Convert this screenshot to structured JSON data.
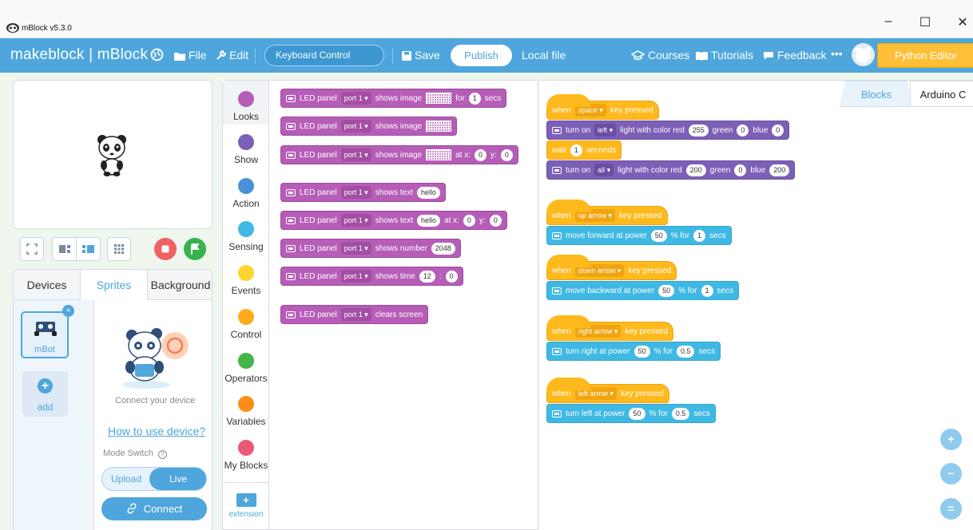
{
  "window": {
    "title": "mBlock v5.3.0",
    "minimize": "–",
    "maximize": "☐",
    "close": "✕"
  },
  "topbar": {
    "brand": "makeblock | mBlock",
    "file": "File",
    "edit": "Edit",
    "project_name": "Keyboard Control",
    "save": "Save",
    "publish": "Publish",
    "local_file": "Local file",
    "courses": "Courses",
    "tutorials": "Tutorials",
    "feedback": "Feedback",
    "more": "•••",
    "python_editor": "Python Editor"
  },
  "left_panel": {
    "tabs": [
      "Devices",
      "Sprites",
      "Background"
    ],
    "active_tab": "Sprites",
    "sprite_name": "mBot",
    "add_label": "add",
    "connect_text": "Connect your device",
    "how_to": "How to use device?",
    "mode_switch": "Mode Switch",
    "upload": "Upload",
    "live": "Live",
    "connect_button": "Connect"
  },
  "categories": [
    {
      "label": "Looks",
      "color": "#b65db7"
    },
    {
      "label": "Show",
      "color": "#7c5fb6"
    },
    {
      "label": "Action",
      "color": "#4a90d9"
    },
    {
      "label": "Sensing",
      "color": "#3fb9e4"
    },
    {
      "label": "Events",
      "color": "#ffd52e"
    },
    {
      "label": "Control",
      "color": "#ffab19"
    },
    {
      "label": "Operators",
      "color": "#43b549"
    },
    {
      "label": "Variables",
      "color": "#ff8c1a"
    },
    {
      "label": "My Blocks",
      "color": "#ea5a78"
    }
  ],
  "extension_label": "extension",
  "palette_blocks": {
    "b1": {
      "t1": "LED panel",
      "port": "port 1 ▾",
      "t2": "shows image",
      "t3": "for",
      "v1": "1",
      "t4": "secs"
    },
    "b2": {
      "t1": "LED panel",
      "port": "port 1 ▾",
      "t2": "shows image"
    },
    "b3": {
      "t1": "LED panel",
      "port": "port 1 ▾",
      "t2": "shows image",
      "t3": "at x:",
      "v1": "0",
      "t4": "y:",
      "v2": "0"
    },
    "b4": {
      "t1": "LED panel",
      "port": "port 1 ▾",
      "t2": "shows text",
      "v1": "hello"
    },
    "b5": {
      "t1": "LED panel",
      "port": "port 1 ▾",
      "t2": "shows text",
      "v1": "hello",
      "t3": "at x:",
      "v2": "0",
      "t4": "y:",
      "v3": "0"
    },
    "b6": {
      "t1": "LED panel",
      "port": "port 1 ▾",
      "t2": "shows number",
      "v1": "2048"
    },
    "b7": {
      "t1": "LED panel",
      "port": "port 1 ▾",
      "t2": "shows time",
      "v1": "12",
      "t3": ":",
      "v2": "0"
    },
    "b8": {
      "t1": "LED panel",
      "port": "port 1 ▾",
      "t2": "clears screen"
    }
  },
  "workspace": {
    "tabs": [
      "Blocks",
      "Arduino C"
    ],
    "s1": {
      "when": "when",
      "key": "space ▾",
      "pressed": "key pressed",
      "l1": {
        "t1": "turn on",
        "dd": "left ▾",
        "t2": "light with color red",
        "v1": "255",
        "t3": "green",
        "v2": "0",
        "t4": "blue",
        "v3": "0"
      },
      "wait": {
        "t1": "wait",
        "v1": "1",
        "t2": "seconds"
      },
      "l2": {
        "t1": "turn on",
        "dd": "all ▾",
        "t2": "light with color red",
        "v1": "200",
        "t3": "green",
        "v2": "0",
        "t4": "blue",
        "v3": "200"
      }
    },
    "s2": {
      "when": "when",
      "key": "up arrow ▾",
      "pressed": "key pressed",
      "t1": "move forward at power",
      "v1": "50",
      "t2": "% for",
      "v2": "1",
      "t3": "secs"
    },
    "s3": {
      "when": "when",
      "key": "down arrow ▾",
      "pressed": "key pressed",
      "t1": "move backward at power",
      "v1": "50",
      "t2": "% for",
      "v2": "1",
      "t3": "secs"
    },
    "s4": {
      "when": "when",
      "key": "right arrow ▾",
      "pressed": "key pressed",
      "t1": "turn right at power",
      "v1": "50",
      "t2": "% for",
      "v2": "0.5",
      "t3": "secs"
    },
    "s5": {
      "when": "when",
      "key": "left arrow ▾",
      "pressed": "key pressed",
      "t1": "turn left at power",
      "v1": "50",
      "t2": "% for",
      "v2": "0.5",
      "t3": "secs"
    },
    "zoom_in": "+",
    "zoom_out": "−",
    "zoom_reset": "="
  },
  "colors": {
    "accent": "#4ea6dc",
    "python_editor": "#ffbf37"
  }
}
